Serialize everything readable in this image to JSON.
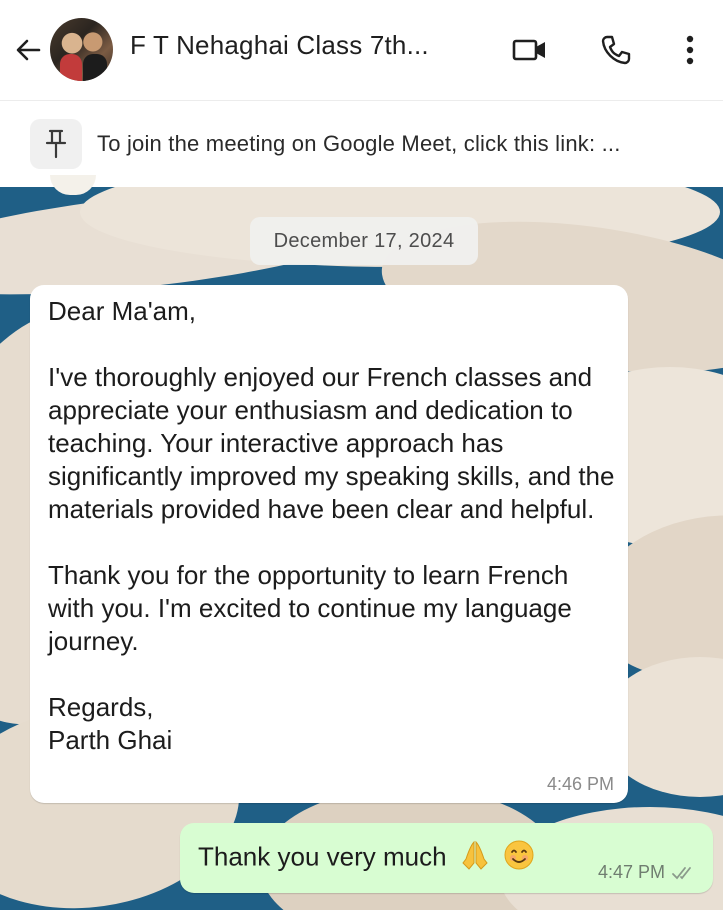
{
  "header": {
    "title": "F T Nehaghai Class 7th...",
    "icons": [
      "back-arrow-icon",
      "group-avatar",
      "video-call-icon",
      "voice-call-icon",
      "more-options-icon"
    ]
  },
  "pinned": {
    "text": "To join the meeting on Google Meet, click this link: ...",
    "icon": "pin-icon"
  },
  "chat": {
    "date_chip": "December 17, 2024",
    "incoming": {
      "text": "Dear Ma'am,\n\nI've thoroughly enjoyed our French classes and appreciate your enthusiasm and dedication to teaching. Your interactive approach has significantly improved my speaking skills, and the materials provided have been clear and helpful.\n\nThank you for the opportunity to learn French with you. I'm excited to continue my language journey.\n\nRegards,\nParth Ghai",
      "time": "4:46 PM"
    },
    "outgoing": {
      "text": "Thank you very much",
      "emojis": [
        "folded-hands-emoji",
        "smiling-face-emoji"
      ],
      "time": "4:47 PM",
      "status": "read-double-check-icon"
    }
  },
  "colors": {
    "header_bg": "#ffffff",
    "incoming_bubble": "#ffffff",
    "outgoing_bubble": "#d8fdd2",
    "wallpaper_water": "#1f5f86",
    "wallpaper_sand": "#e7ddd0"
  }
}
